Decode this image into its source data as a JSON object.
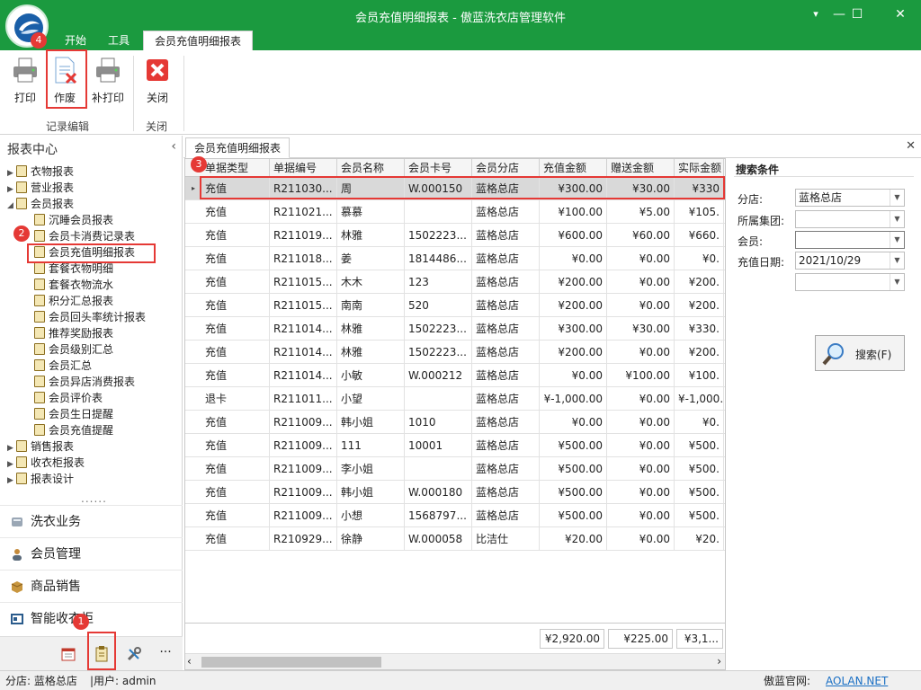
{
  "window": {
    "title": "会员充值明细报表 - 傲蓝洗衣店管理软件",
    "minimize": "—",
    "restore": "☐",
    "close": "✕",
    "menu": "▾"
  },
  "ribbon": {
    "tabs": [
      "开始",
      "工具",
      "会员充值明细报表"
    ],
    "buttons": {
      "print": "打印",
      "void": "作废",
      "reprint": "补打印",
      "close": "关闭"
    },
    "groups": {
      "edit": "记录编辑",
      "close": "关闭"
    }
  },
  "badges": {
    "one": "1",
    "two": "2",
    "three": "3",
    "four": "4"
  },
  "left": {
    "header": "报表中心",
    "collapse": "‹",
    "grip": "......",
    "tree": [
      "衣物报表",
      "营业报表",
      "会员报表",
      "沉睡会员报表",
      "会员卡消费记录表",
      "会员充值明细报表",
      "套餐衣物明细",
      "套餐衣物流水",
      "积分汇总报表",
      "会员回头率统计报表",
      "推荐奖励报表",
      "会员级别汇总",
      "会员汇总",
      "会员异店消费报表",
      "会员评价表",
      "会员生日提醒",
      "会员充值提醒",
      "销售报表",
      "收衣柜报表",
      "报表设计"
    ],
    "nav": [
      "洗衣业务",
      "会员管理",
      "商品销售",
      "智能收衣柜"
    ],
    "more": "···"
  },
  "doc_tab": {
    "title": "会员充值明细报表",
    "close": "✕"
  },
  "grid": {
    "columns": [
      "单据类型",
      "单据编号",
      "会员名称",
      "会员卡号",
      "会员分店",
      "充值金额",
      "赠送金额",
      "实际金额"
    ],
    "rows": [
      [
        "充值",
        "R211030...",
        "周",
        "W.000150",
        "蓝格总店",
        "¥300.00",
        "¥30.00",
        "¥330"
      ],
      [
        "充值",
        "R211021...",
        "慕慕",
        "",
        "蓝格总店",
        "¥100.00",
        "¥5.00",
        "¥105."
      ],
      [
        "充值",
        "R211019...",
        "林雅",
        "1502223...",
        "蓝格总店",
        "¥600.00",
        "¥60.00",
        "¥660."
      ],
      [
        "充值",
        "R211018...",
        "姜",
        "1814486...",
        "蓝格总店",
        "¥0.00",
        "¥0.00",
        "¥0."
      ],
      [
        "充值",
        "R211015...",
        "木木",
        "123",
        "蓝格总店",
        "¥200.00",
        "¥0.00",
        "¥200."
      ],
      [
        "充值",
        "R211015...",
        "南南",
        "520",
        "蓝格总店",
        "¥200.00",
        "¥0.00",
        "¥200."
      ],
      [
        "充值",
        "R211014...",
        "林雅",
        "1502223...",
        "蓝格总店",
        "¥300.00",
        "¥30.00",
        "¥330."
      ],
      [
        "充值",
        "R211014...",
        "林雅",
        "1502223...",
        "蓝格总店",
        "¥200.00",
        "¥0.00",
        "¥200."
      ],
      [
        "充值",
        "R211014...",
        "小敏",
        "W.000212",
        "蓝格总店",
        "¥0.00",
        "¥100.00",
        "¥100."
      ],
      [
        "退卡",
        "R211011...",
        "小望",
        "",
        "蓝格总店",
        "¥-1,000.00",
        "¥0.00",
        "¥-1,000."
      ],
      [
        "充值",
        "R211009...",
        "韩小姐",
        "1010",
        "蓝格总店",
        "¥0.00",
        "¥0.00",
        "¥0."
      ],
      [
        "充值",
        "R211009...",
        "111",
        "10001",
        "蓝格总店",
        "¥500.00",
        "¥0.00",
        "¥500."
      ],
      [
        "充值",
        "R211009...",
        "李小姐",
        "",
        "蓝格总店",
        "¥500.00",
        "¥0.00",
        "¥500."
      ],
      [
        "充值",
        "R211009...",
        "韩小姐",
        "W.000180",
        "蓝格总店",
        "¥500.00",
        "¥0.00",
        "¥500."
      ],
      [
        "充值",
        "R211009...",
        "小想",
        "1568797...",
        "蓝格总店",
        "¥500.00",
        "¥0.00",
        "¥500."
      ],
      [
        "充值",
        "R210929...",
        "徐静",
        "W.000058",
        "比洁仕",
        "¥20.00",
        "¥0.00",
        "¥20."
      ]
    ],
    "selected_row_marker": "▸",
    "summary": [
      "¥2,920.00",
      "¥225.00",
      "¥3,1..."
    ],
    "scroll_left": "‹",
    "scroll_right": "›"
  },
  "search": {
    "title": "搜索条件",
    "fields": [
      {
        "label": "分店:",
        "value": "蓝格总店"
      },
      {
        "label": "所属集团:",
        "value": ""
      },
      {
        "label": "会员:",
        "value": ""
      },
      {
        "label": "充值日期:",
        "value": "2021/10/29"
      },
      {
        "label": "",
        "value": ""
      }
    ],
    "button": "搜索(F)"
  },
  "status": {
    "store": "分店: 蓝格总店",
    "user": "|用户: admin",
    "site_label": "傲蓝官网:",
    "site_link": "AOLAN.NET"
  },
  "colors": {
    "title_green": "#1b9a3f",
    "highlight": "#e53935",
    "link": "#1a6fc4"
  }
}
